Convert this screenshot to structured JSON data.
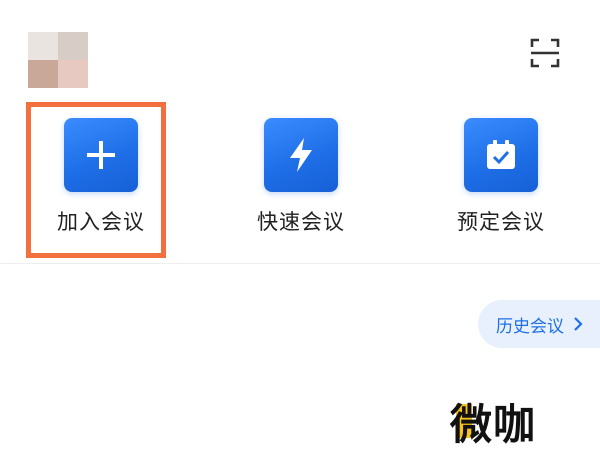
{
  "header": {
    "scan_icon": "scan-icon",
    "avatar": "user-avatar"
  },
  "actions": [
    {
      "label": "加入会议",
      "icon": "plus-icon"
    },
    {
      "label": "快速会议",
      "icon": "lightning-icon"
    },
    {
      "label": "预定会议",
      "icon": "calendar-check-icon"
    }
  ],
  "history": {
    "label": "历史会议",
    "icon": "chevron-right-icon"
  },
  "watermark": {
    "text": "微咖"
  },
  "colors": {
    "accent_blue": "#1f6fe8",
    "highlight_orange": "#f2703d",
    "history_bg": "#e7f0fc",
    "watermark_yellow": "#f6c21c"
  }
}
